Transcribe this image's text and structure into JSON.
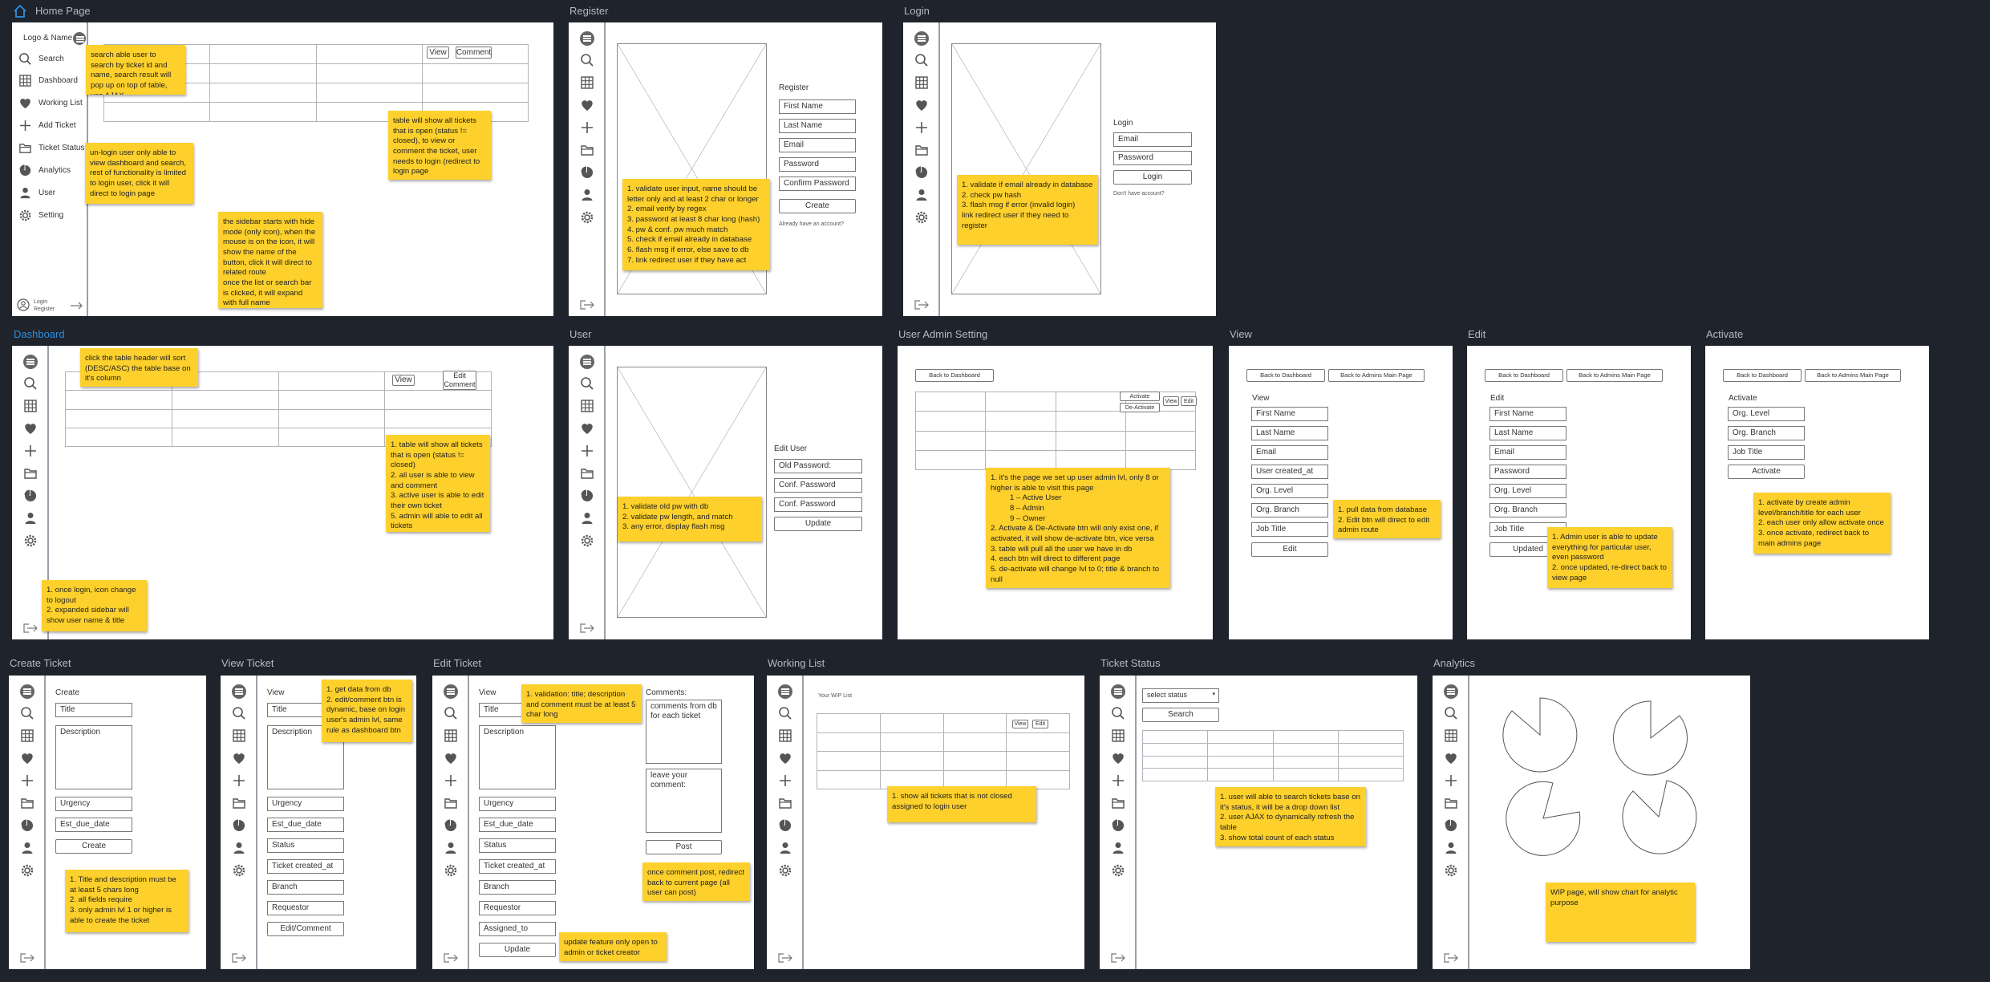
{
  "titles": {
    "home": "Home Page",
    "register": "Register",
    "login": "Login",
    "dashboard": "Dashboard",
    "user": "User",
    "useradmin": "User Admin Setting",
    "view": "View",
    "edit": "Edit",
    "activate": "Activate",
    "create": "Create Ticket",
    "viewticket": "View Ticket",
    "editticket": "Edit Ticket",
    "working": "Working List",
    "status": "Ticket Status",
    "analytics": "Analytics"
  },
  "home": {
    "logo": "Logo & Name",
    "menu": [
      "Search",
      "Dashboard",
      "Working List",
      "Add Ticket",
      "Ticket Status",
      "Analytics",
      "User",
      "Setting"
    ],
    "login": "Login",
    "register": "Register",
    "view": "View",
    "comment": "Comment",
    "notes": [
      "search able user to search by ticket id and name, search result will pop up on top of table, use AJAX",
      "un-login user only able to view dashboard and search, rest of functionality is limited to login user, click it will direct to login page",
      "the sidebar starts with hide mode (only icon), when the mouse is on the icon, it will show the name of the button, click it will direct to related route",
      "once the list or search bar is clicked, it will expand with full name",
      "table will show all tickets that is open (status != closed), to view or comment the ticket, user needs to login (redirect to login page"
    ]
  },
  "register": {
    "heading": "Register",
    "fields": [
      "First Name",
      "Last Name",
      "Email",
      "Password",
      "Confirm Password"
    ],
    "button": "Create",
    "link": "Already have an account?",
    "note": "1. validate user input, name should be letter only and at least 2 char or longer\n2. email verify by regex\n3. password at least 8 char long (hash)\n4. pw & conf. pw much match\n5. check if email already in database\n6. flash msg if error, else save to db\n7. link redirect user if they have act"
  },
  "login": {
    "heading": "Login",
    "fields": [
      "Email",
      "Password"
    ],
    "button": "Login",
    "link": "Don't have account?",
    "note": "1. validate if email already in database\n2. check pw hash\n3. flash msg if error (invalid login)\nlink redirect user if they need to register"
  },
  "dashboard": {
    "view": "View",
    "edit": "Edit",
    "comment": "Comment",
    "notes": [
      "click the table header will sort (DESC/ASC) the table base on it's column",
      "1. table will show all tickets that is open (status != closed)\n2. all user is able to view and comment\n3. active user is able to edit their own ticket\n5. admin will able to edit all tickets",
      "1. once login, icon change to logout\n2. expanded sidebar will show user name & title"
    ]
  },
  "user": {
    "heading": "Edit User",
    "fields": [
      "Old Password:",
      "Conf. Password",
      "Conf. Password"
    ],
    "button": "Update",
    "note": "1. validate old pw with db\n2. validate pw length, and match\n3. any error, display flash msg"
  },
  "useradmin": {
    "back": "Back to Dashboard",
    "activate": "Activate",
    "deactivate": "De-Activate",
    "view": "View",
    "edit": "Edit",
    "note_intro": "1. it's the page we set up user admin lvl, only 8 or higher is able to visit this page",
    "note_levels": [
      "1 – Active User",
      "8 – Admin",
      "9 – Owner"
    ],
    "note_rest": "2. Activate & De-Activate btn will only exist one, if activated, it will show de-activate btn, vice versa\n3. table will pull all the user we have in db\n4. each btn will direct to different page\n5. de-activate will change lvl to 0; title & branch to null"
  },
  "view": {
    "back": "Back to Dashboard",
    "back_admin": "Back to Admins Main Page",
    "heading": "View",
    "fields": [
      "First Name",
      "Last Name",
      "Email",
      "User created_at",
      "Org. Level",
      "Org. Branch",
      "Job Title"
    ],
    "button": "Edit",
    "note": "1. pull data from database\n2. Edit btn will direct to edit admin route"
  },
  "edit": {
    "back": "Back to Dashboard",
    "back_admin": "Back to Admins Main Page",
    "heading": "Edit",
    "fields": [
      "First Name",
      "Last Name",
      "Email",
      "Password",
      "Org. Level",
      "Org. Branch",
      "Job Title"
    ],
    "button": "Updated",
    "note": "1. Admin user is able to update everything for particular user, even password\n2. once updated, re-direct back to view page"
  },
  "activate": {
    "back": "Back to Dashboard",
    "back_admin": "Back to Admins Main Page",
    "heading": "Activate",
    "fields": [
      "Org. Level",
      "Org. Branch",
      "Job Title"
    ],
    "button": "Activate",
    "note": "1. activate by create admin level/branch/title for each user\n2. each user only allow activate once\n3. once activate, redirect back to main admins page"
  },
  "create": {
    "heading": "Create",
    "title": "Title",
    "description": "Description",
    "urgency": "Urgency",
    "due": "Est_due_date",
    "button": "Create",
    "note": "1. Title and description must be at least 5 chars long\n2. all fields require\n3. only admin lvl 1 or higher is able to create the ticket"
  },
  "viewticket": {
    "heading": "View",
    "title": "Title",
    "description": "Description",
    "fields": [
      "Urgency",
      "Est_due_date",
      "Status",
      "Ticket created_at",
      "Branch",
      "Requestor"
    ],
    "button": "Edit/Comment",
    "note": "1. get data from db\n2. edit/comment btn is dynamic, base on login user's admin lvl, same rule as dashboard btn"
  },
  "editticket": {
    "heading": "View",
    "title": "Title",
    "description": "Description",
    "fields": [
      "Urgency",
      "Est_due_date",
      "Status",
      "Ticket created_at",
      "Branch",
      "Requestor",
      "Assigned_to"
    ],
    "button": "Update",
    "comments": "Comments:",
    "comments_box": "comments from db for each ticket",
    "leave": "leave your comment:",
    "post": "Post",
    "notes": [
      "1. validation: title; description and comment must be at least 5 char long",
      "once comment post, redirect back to current page (all user can post)",
      "update feature only open to admin or ticket creator"
    ]
  },
  "working": {
    "heading": "Your WIP List",
    "view": "View",
    "edit": "Edit",
    "note": "1. show all tickets that is not closed assigned to login user"
  },
  "status": {
    "select": "select status",
    "search": "Search",
    "note": "1. user will able to search tickets base on it's status, it will be a drop down list\n2. user AJAX to dynamically refresh the table\n3. show total count of each status"
  },
  "analytics": {
    "note": "WIP page, will show chart for analytic purpose"
  },
  "icons": [
    "menu-icon",
    "search-icon",
    "grid-icon",
    "heart-icon",
    "plus-icon",
    "folder-icon",
    "pie-icon",
    "user-icon",
    "gear-icon",
    "logout-icon",
    "home-icon"
  ],
  "colors": {
    "background": "#1e232c",
    "note": "#fdd02c",
    "active_title": "#2f8fe0"
  }
}
